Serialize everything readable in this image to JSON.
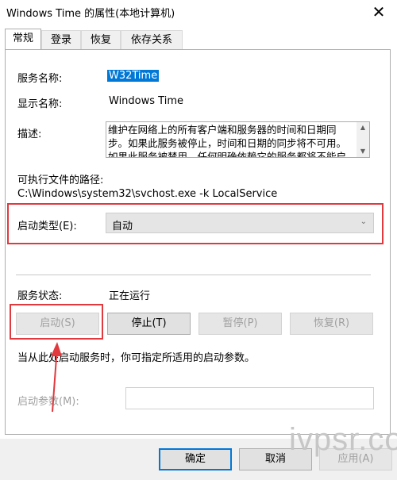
{
  "window": {
    "title": "Windows Time 的属性(本地计算机)",
    "close_label": "✕"
  },
  "tabs": [
    {
      "label": "常规",
      "active": true
    },
    {
      "label": "登录"
    },
    {
      "label": "恢复"
    },
    {
      "label": "依存关系"
    }
  ],
  "general": {
    "service_name_label": "服务名称:",
    "service_name_value": "W32Time",
    "display_name_label": "显示名称:",
    "display_name_value": "Windows Time",
    "description_label": "描述:",
    "description_text": "维护在网络上的所有客户端和服务器的时间和日期同步。如果此服务被停止，时间和日期的同步将不可用。如果此服务被禁用，任何明确依赖它的服务都将不能启动。",
    "path_label": "可执行文件的路径:",
    "path_value": "C:\\Windows\\system32\\svchost.exe -k LocalService",
    "startup_type_label": "启动类型(E):",
    "startup_type_value": "自动",
    "service_status_label": "服务状态:",
    "service_status_value": "正在运行",
    "buttons": {
      "start": "启动(S)",
      "stop": "停止(T)",
      "pause": "暂停(P)",
      "resume": "恢复(R)"
    },
    "hint_text": "当从此处启动服务时，你可指定所适用的启动参数。",
    "start_params_label": "启动参数(M):",
    "start_params_value": ""
  },
  "watermark": "ivpsr.com",
  "footer": {
    "ok": "确定",
    "cancel": "取消",
    "apply": "应用(A)"
  },
  "annotation_color": "#e0393e"
}
